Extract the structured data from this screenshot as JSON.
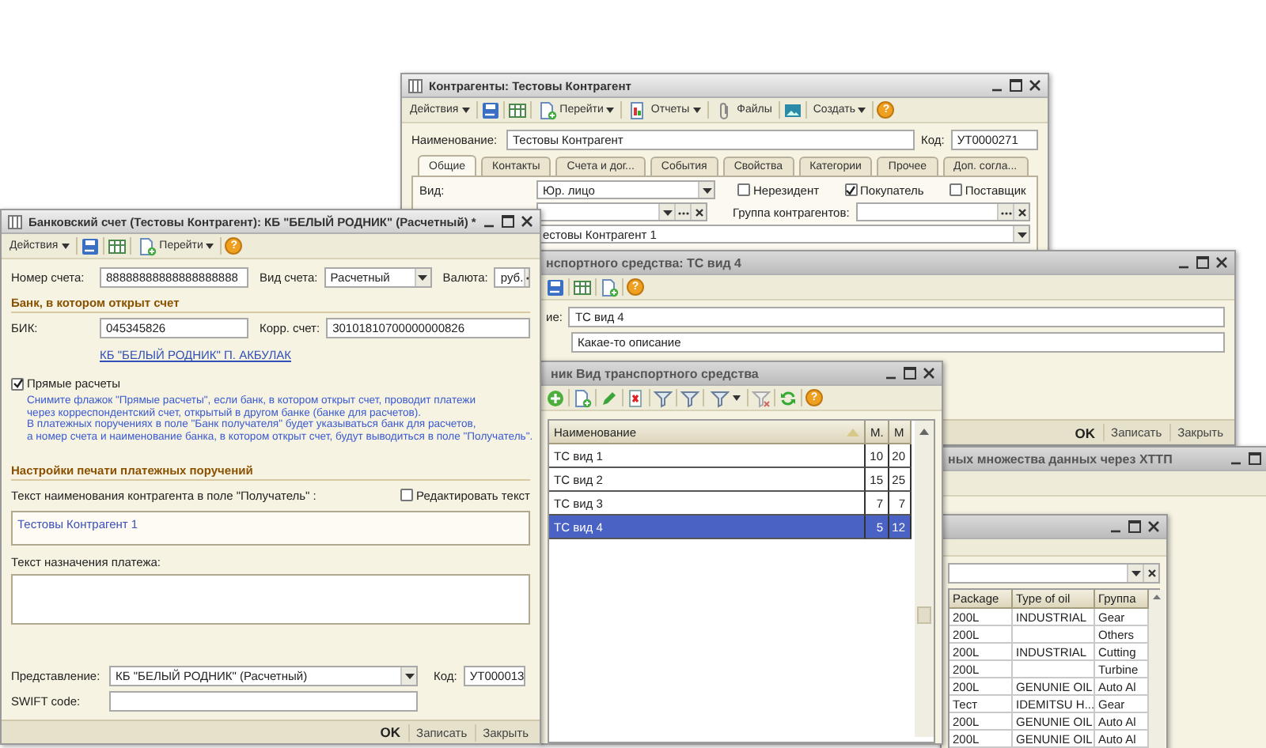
{
  "counterparty_window": {
    "title": "Контрагенты: Тестовы Контрагент",
    "toolbar": [
      {
        "kind": "text",
        "label": "Действия",
        "dropdown": true
      },
      {
        "kind": "save"
      },
      {
        "kind": "table"
      },
      {
        "kind": "copy",
        "label": "Перейти",
        "dropdown": true
      },
      {
        "kind": "report",
        "label": "Отчеты",
        "dropdown": true
      },
      {
        "kind": "clip",
        "label": "Файлы"
      },
      {
        "kind": "photo"
      },
      {
        "kind": "text",
        "label": "Создать",
        "dropdown": true
      },
      {
        "kind": "help",
        "label": "?"
      }
    ],
    "name_label": "Наименование:",
    "name_value": "Тестовы Контрагент",
    "code_label": "Код:",
    "code_value": "УТ0000271",
    "tabs": [
      {
        "label": "Общие",
        "selected": true
      },
      {
        "label": "Контакты",
        "selected": false
      },
      {
        "label": "Счета и дог...",
        "selected": false
      },
      {
        "label": "События",
        "selected": false
      },
      {
        "label": "Свойства",
        "selected": false
      },
      {
        "label": "Категории",
        "selected": false
      },
      {
        "label": "Прочее",
        "selected": false
      },
      {
        "label": "Доп. согла...",
        "selected": false
      }
    ],
    "type_label": "Вид:",
    "type_value": "Юр. лицо",
    "checkboxes": [
      {
        "label": "Нерезидент",
        "checked": false
      },
      {
        "label": "Покупатель",
        "checked": true
      },
      {
        "label": "Поставщик",
        "checked": false
      }
    ],
    "group_label": "Группа контрагентов:",
    "contact_value": "естовы Контрагент 1"
  },
  "bank_window": {
    "title": "Банковский счет (Тестовы Контрагент): КБ \"БЕЛЫЙ РОДНИК\" (Расчетный) *",
    "toolbar": [
      {
        "kind": "text",
        "label": "Действия",
        "dropdown": true
      },
      {
        "kind": "save"
      },
      {
        "kind": "table"
      },
      {
        "kind": "copy",
        "label": "Перейти",
        "dropdown": true
      },
      {
        "kind": "help",
        "label": "?"
      }
    ],
    "account_label": "Номер счета:",
    "account_value": "88888888888888888888",
    "account_type_label": "Вид счета:",
    "account_type_value": "Расчетный",
    "currency_label": "Валюта:",
    "currency_value": "руб.",
    "bank_section": "Банк, в котором открыт счет",
    "bik_label": "БИК:",
    "bik_value": "045345826",
    "corr_label": "Корр. счет:",
    "corr_value": "30101810700000000826",
    "bank_link": "КБ \"БЕЛЫЙ РОДНИК\" П. АКБУЛАК",
    "direct_payments": {
      "label": "Прямые расчеты",
      "checked": true
    },
    "hint_lines": [
      "Снимите флажок \"Прямые расчеты\", если банк, в котором открыт счет, проводит платежи",
      "через корреспондентский счет, открытый в другом банке (банке для расчетов).",
      "В платежных поручениях в поле \"Банк получателя\" будет указываться банк для расчетов,",
      "а номер счета и наименование банка, в котором открыт счет, будут выводиться в поле \"Получатель\"."
    ],
    "print_section": "Настройки печати платежных поручений",
    "recipient_label": "Текст наименования контрагента в поле \"Получатель\" :",
    "edit_text": {
      "label": "Редактировать текст",
      "checked": false
    },
    "recipient_text": "Тестовы Контрагент 1",
    "purpose_label": "Текст назначения платежа:",
    "presentation_label": "Представление:",
    "presentation_value": "КБ \"БЕЛЫЙ РОДНИК\" (Расчетный)",
    "code_label": "Код:",
    "code_value": "УТ000013",
    "swift_label": "SWIFT code:",
    "buttons": [
      {
        "label": "OK",
        "default": true
      },
      {
        "label": "Записать",
        "default": false
      },
      {
        "label": "Закрыть",
        "default": false
      }
    ]
  },
  "vehicle_window": {
    "title": "нспортного средства: ТС вид 4",
    "toolbar": [
      {
        "kind": "save"
      },
      {
        "kind": "table"
      },
      {
        "kind": "copy"
      },
      {
        "kind": "help",
        "label": "?"
      }
    ],
    "name_label": "ие:",
    "name_value": "ТС вид 4",
    "description_value": "Какае-то описание",
    "buttons": [
      {
        "label": "OK",
        "default": true
      },
      {
        "label": "Записать",
        "default": false
      },
      {
        "label": "Закрыть",
        "default": false
      }
    ]
  },
  "vehicle_list_window": {
    "title": "ник Вид транспортного средства",
    "toolbar": [
      {
        "kind": "add"
      },
      {
        "kind": "copy"
      },
      {
        "kind": "edit"
      },
      {
        "kind": "delete"
      },
      {
        "kind": "filter"
      },
      {
        "kind": "filter"
      },
      {
        "kind": "filter",
        "dropdown": true
      },
      {
        "kind": "filterclear"
      },
      {
        "kind": "refresh"
      },
      {
        "kind": "help",
        "label": "?"
      }
    ],
    "columns": [
      "Наименование",
      "М.",
      "М"
    ],
    "rows": [
      {
        "cells": [
          "ТС вид 1",
          "10",
          "20"
        ],
        "selected": false
      },
      {
        "cells": [
          "ТС вид 2",
          "15",
          "25"
        ],
        "selected": false
      },
      {
        "cells": [
          "ТС вид 3",
          "7",
          "7"
        ],
        "selected": false
      },
      {
        "cells": [
          "ТС вид 4",
          "5",
          "12"
        ],
        "selected": true
      }
    ]
  },
  "http_window": {
    "title": "ных множества данных через ХТТП"
  },
  "oil_window": {
    "columns": [
      "Package",
      "Type of oil",
      "Группа"
    ],
    "rows": [
      {
        "cells": [
          "200L",
          "INDUSTRIAL",
          "Gear"
        ]
      },
      {
        "cells": [
          "200L",
          "",
          "Others"
        ]
      },
      {
        "cells": [
          "200L",
          "INDUSTRIAL",
          "Cutting"
        ]
      },
      {
        "cells": [
          "200L",
          "",
          "Turbine"
        ]
      },
      {
        "cells": [
          "200L",
          "GENUNIE OIL",
          "Auto Al"
        ]
      },
      {
        "cells": [
          "Тест",
          "IDEMITSU H...",
          "Gear"
        ]
      },
      {
        "cells": [
          "200L",
          "GENUNIE OIL",
          "Auto Al"
        ]
      },
      {
        "cells": [
          "200L",
          "GENUNIE OIL",
          "Auto Al"
        ]
      }
    ]
  }
}
